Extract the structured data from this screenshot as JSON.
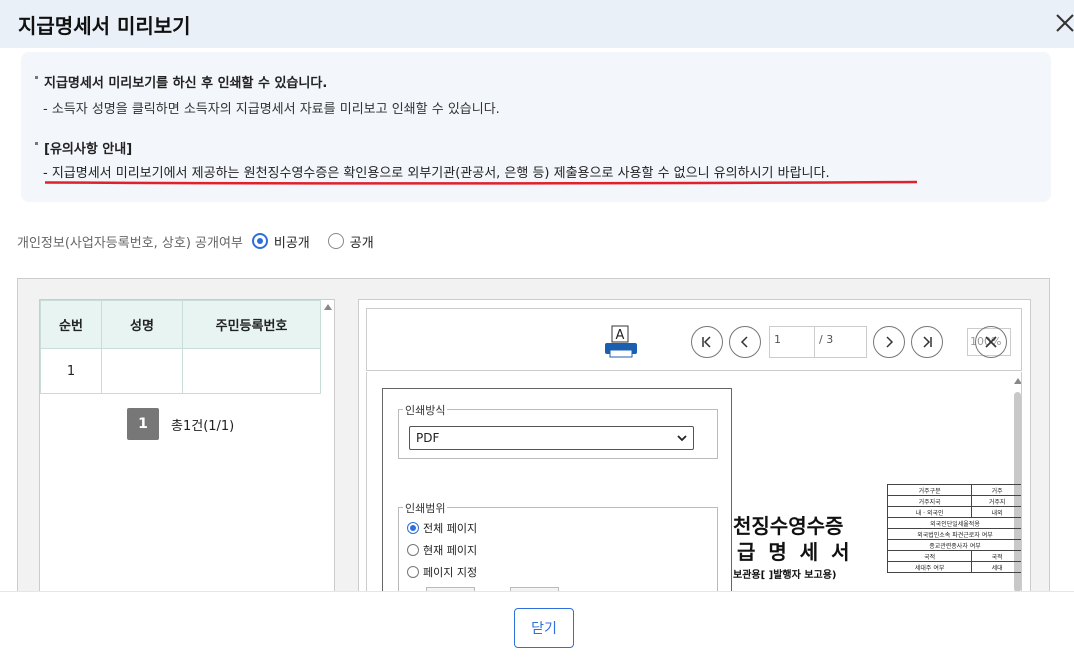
{
  "dialog": {
    "title": "지급명세서 미리보기",
    "close_label": "닫기"
  },
  "notice": {
    "line1": "지급명세서 미리보기를 하신 후 인쇄할 수 있습니다.",
    "line2": "- 소득자 성명을 클릭하면 소득자의 지급명세서 자료를 미리보고 인쇄할 수 있습니다.",
    "line3": "[유의사항 안내]",
    "line4": "- 지급명세서 미리보기에서 제공하는 원천징수영수증은 확인용으로 외부기관(관공서, 은행 등) 제출용으로 사용할 수 없으니 유의하시기 바랍니다.",
    "underline_color": "#e0202a"
  },
  "privacy": {
    "label": "개인정보(사업자등록번호, 상호) 공개여부",
    "options": [
      {
        "label": "비공개",
        "selected": true
      },
      {
        "label": "공개",
        "selected": false
      }
    ]
  },
  "list": {
    "columns": [
      "순번",
      "성명",
      "주민등록번호"
    ],
    "rows": [
      {
        "no": "1",
        "name": "",
        "id": ""
      }
    ],
    "page": "1",
    "total": "총1건(1/1)"
  },
  "viewer": {
    "print_icon_letter": "A",
    "current_page": "1",
    "total_pages": "/ 3",
    "zoom": "100%",
    "print_dialog": {
      "method_legend": "인쇄방식",
      "method_value": "PDF",
      "range_legend": "인쇄범위",
      "range_options": [
        {
          "label": "전체 페이지",
          "selected": true
        },
        {
          "label": "현재 페이지",
          "selected": false
        },
        {
          "label": "페이지 지정",
          "selected": false
        }
      ]
    },
    "document": {
      "title1": "천징수영수증",
      "title2": "급 명 세 서",
      "subtitle": "보관용[    ]발행자 보고용)",
      "table_rows": [
        [
          "거주구분",
          "거주"
        ],
        [
          "거주지국",
          "거주지"
        ],
        [
          "내 · 외국인",
          "내외"
        ],
        [
          "외국인단일세율적용",
          ""
        ],
        [
          "외국법인소속 파견근로자 여부",
          ""
        ],
        [
          "종교관련종사자 여부",
          ""
        ],
        [
          "국적",
          "국적"
        ],
        [
          "세대주 여부",
          "세대"
        ]
      ]
    }
  },
  "colors": {
    "accent": "#2f6fdc",
    "header_bg": "#eaf0f8",
    "table_header_bg": "#e8f4f2"
  }
}
